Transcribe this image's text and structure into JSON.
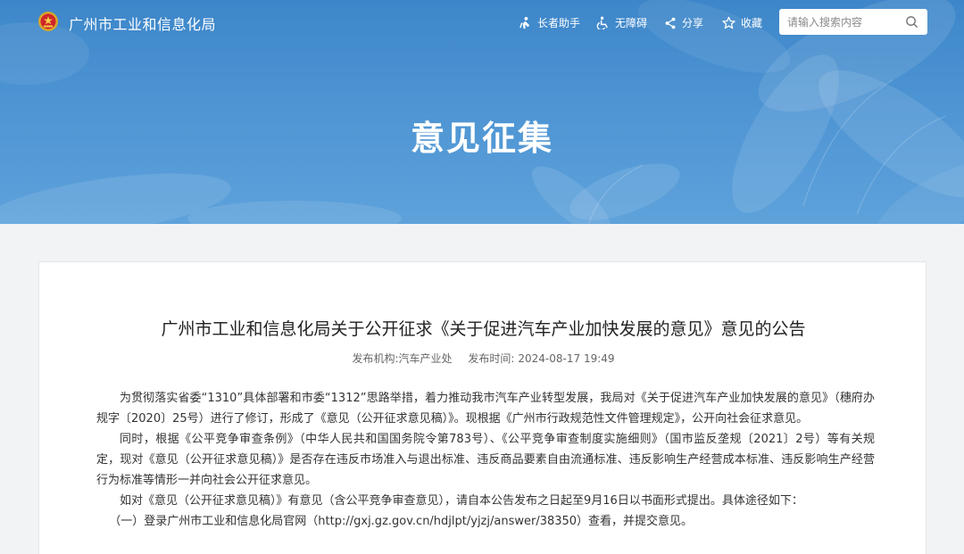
{
  "header": {
    "site_title": "广州市工业和信息化局",
    "tools": [
      {
        "label": "长者助手",
        "icon": "elder-helper-icon"
      },
      {
        "label": "无障碍",
        "icon": "accessibility-icon"
      },
      {
        "label": "分享",
        "icon": "share-icon"
      },
      {
        "label": "收藏",
        "icon": "star-icon"
      }
    ],
    "search": {
      "placeholder": "请输入搜索内容",
      "value": "",
      "icon": "search-icon"
    },
    "banner_title": "意见征集"
  },
  "colors": {
    "banner_blue": "#4d94d3",
    "page_bg": "#f2f3f5",
    "text_dark": "#222222",
    "text_meta": "#666666"
  },
  "article": {
    "title": "广州市工业和信息化局关于公开征求《关于促进汽车产业加快发展的意见》意见的公告",
    "meta": {
      "publisher_label": "发布机构:",
      "publisher": "汽车产业处",
      "time_label": "发布时间:",
      "time": "2024-08-17 19:49"
    },
    "paragraphs": [
      "为贯彻落实省委“1310”具体部署和市委“1312”思路举措，着力推动我市汽车产业转型发展，我局对《关于促进汽车产业加快发展的意见》（穗府办规字〔2020〕25号）进行了修订，形成了《意见（公开征求意见稿）》。现根据《广州市行政规范性文件管理规定》，公开向社会征求意见。",
      "同时，根据《公平竞争审查条例》（中华人民共和国国务院令第783号）、《公平竞争审查制度实施细则》（国市监反垄规〔2021〕2号）等有关规定，现对《意见（公开征求意见稿）》是否存在违反市场准入与退出标准、违反商品要素自由流通标准、违反影响生产经营成本标准、违反影响生产经营行为标准等情形一并向社会公开征求意见。",
      "如对《意见（公开征求意见稿）》有意见（含公平竞争审查意见），请自本公告发布之日起至9月16日以书面形式提出。具体途径如下："
    ],
    "item_1": "（一）登录广州市工业和信息化局官网（http://gxj.gz.gov.cn/hdjlpt/yjzj/answer/38350）查看，并提交意见。"
  }
}
